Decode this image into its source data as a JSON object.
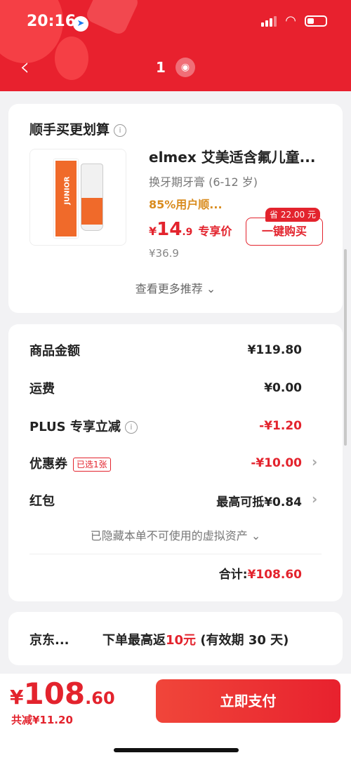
{
  "status_bar": {
    "time": "20:16"
  },
  "nav": {
    "back_icon": "chevron-left-icon",
    "count": "1",
    "location_icon": "location-pin-icon"
  },
  "recommend": {
    "title": "顺手买更划算",
    "product": {
      "name": "elmex 艾美适含氟儿童...",
      "subtitle": "换牙期牙膏 (6-12 岁)",
      "rating": "85%用户顺...",
      "price_currency": "¥",
      "price_int": "14",
      "price_dec": ".9",
      "price_tag": "专享价",
      "original_price": "¥36.9",
      "save_badge": "省 22.00 元",
      "buy_label": "一键购买",
      "image_brand": "elmex",
      "image_line": "JUNIOR"
    },
    "more_label": "查看更多推荐"
  },
  "summary": {
    "rows": [
      {
        "label": "商品金额",
        "value": "¥119.80"
      },
      {
        "label": "运费",
        "value": "¥0.00"
      },
      {
        "label": "PLUS 专享立减",
        "value": "-¥1.20"
      },
      {
        "label": "优惠券",
        "tag": "已选1张",
        "value": "-¥10.00"
      },
      {
        "label": "红包",
        "value": "最高可抵¥0.84"
      }
    ],
    "hidden_note": "已隐藏本单不可使用的虚拟资产",
    "total_label": "合计:",
    "total_amount": "¥108.60"
  },
  "rebate": {
    "name": "京东...",
    "text_prefix": "下单最高返",
    "text_amount": "10元",
    "text_suffix": " (有效期 30 天)"
  },
  "bottom_bar": {
    "currency": "¥",
    "amount_int": "108",
    "amount_dec": ".60",
    "saved": "共减¥11.20",
    "pay_label": "立即支付"
  },
  "colors": {
    "brand_red": "#e8212e",
    "price_red": "#e3232d",
    "rating_orange": "#d98c1f"
  }
}
